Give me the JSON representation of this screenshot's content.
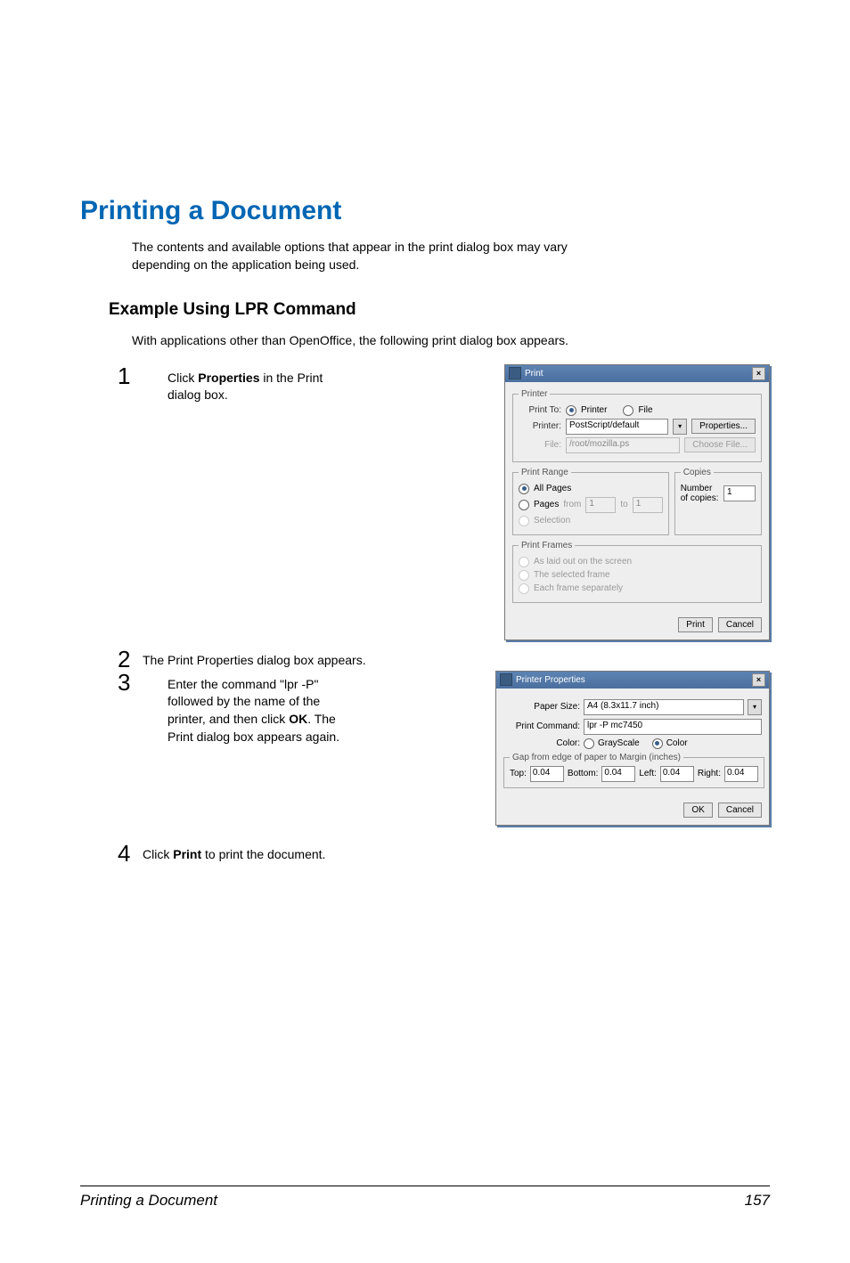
{
  "title": "Printing a Document",
  "intro1": "The contents and available options that appear in the print dialog box may vary depending on the application being used.",
  "subhead": "Example Using LPR Command",
  "intro2": "With applications other than OpenOffice, the following print dialog box appears.",
  "steps": {
    "s1a": "Click ",
    "s1b": "Properties",
    "s1c": " in the Print dialog box.",
    "s2": "The Print Properties dialog box appears.",
    "s3a": "Enter the command \"lpr -P\" followed by the name of the printer, and then click ",
    "s3b": "OK",
    "s3c": ". The Print dialog box appears again.",
    "s4a": "Click ",
    "s4b": "Print",
    "s4c": " to print the document."
  },
  "dialog1": {
    "title": "Print",
    "grp_printer": "Printer",
    "print_to": "Print To:",
    "opt_printer": "Printer",
    "opt_file": "File",
    "printer_lbl": "Printer:",
    "printer_val": "PostScript/default",
    "props_btn": "Properties...",
    "file_lbl": "File:",
    "file_val": "/root/mozilla.ps",
    "choose_btn": "Choose File...",
    "grp_range": "Print Range",
    "all_pages": "All Pages",
    "pages": "Pages",
    "from": "from",
    "from_v": "1",
    "to": "to",
    "to_v": "1",
    "selection": "Selection",
    "grp_copies": "Copies",
    "num_copies": "Number of copies:",
    "copies_v": "1",
    "grp_frames": "Print Frames",
    "f1": "As laid out on the screen",
    "f2": "The selected frame",
    "f3": "Each frame separately",
    "print_btn": "Print",
    "cancel_btn": "Cancel"
  },
  "dialog2": {
    "title": "Printer Properties",
    "paper_size_lbl": "Paper Size:",
    "paper_size_val": "A4 (8.3x11.7 inch)",
    "cmd_lbl": "Print Command:",
    "cmd_val": "lpr -P mc7450",
    "color_lbl": "Color:",
    "gray": "GrayScale",
    "color": "Color",
    "gap": "Gap from edge of paper to Margin (inches)",
    "top": "Top:",
    "bottom": "Bottom:",
    "left": "Left:",
    "right": "Right:",
    "v": "0.04",
    "ok": "OK",
    "cancel": "Cancel"
  },
  "footer": {
    "left": "Printing a Document",
    "page": "157"
  }
}
